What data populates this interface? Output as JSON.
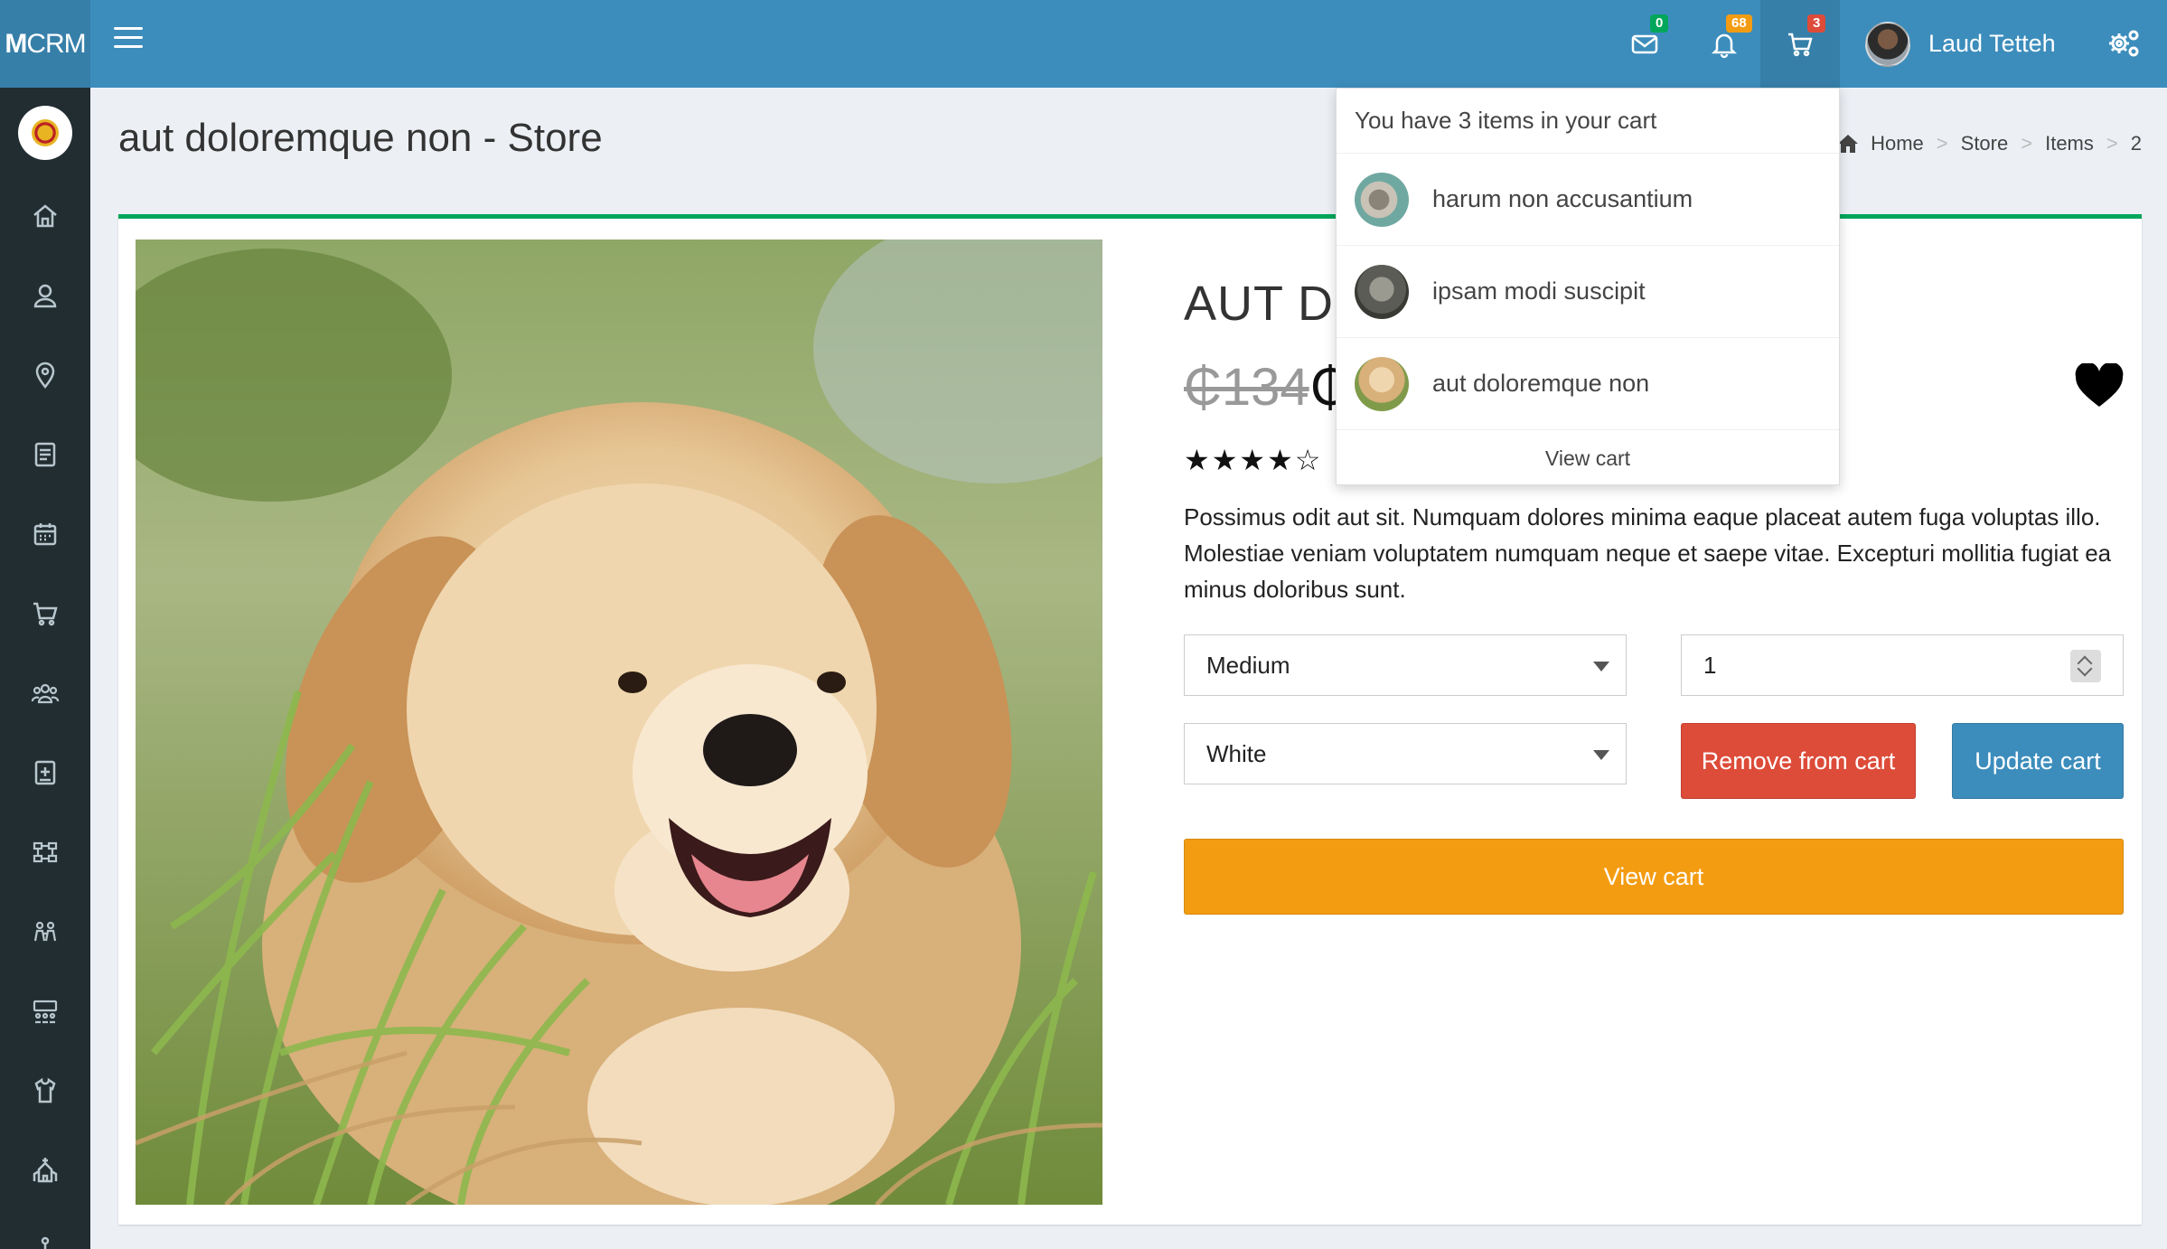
{
  "header": {
    "logo_bold": "M",
    "logo_rest": "CRM",
    "mail_count": "0",
    "notif_count": "68",
    "cart_count": "3",
    "user_name": "Laud Tetteh"
  },
  "page": {
    "title": "aut doloremque non - Store",
    "breadcrumb": [
      "Home",
      "Store",
      "Items",
      "2"
    ]
  },
  "product": {
    "name": "AUT DC",
    "old_price": "₵134",
    "current_price": "₵",
    "rating": 4,
    "rating_max": 5,
    "stars": "★★★★☆",
    "description": "Possimus odit aut sit. Numquam dolores minima eaque placeat autem fuga voluptas illo. Molestiae veniam voluptatem numquam neque et saepe vitae. Excepturi mollitia fugiat ea minus doloribus sunt.",
    "size": "Medium",
    "color": "White",
    "quantity": "1",
    "remove_label": "Remove from cart",
    "update_label": "Update cart",
    "view_cart_label": "View cart"
  },
  "cart_dropdown": {
    "header": "You have 3 items in your cart",
    "items": [
      {
        "name": "harum non accusantium"
      },
      {
        "name": "ipsam modi suscipit"
      },
      {
        "name": "aut doloremque non"
      }
    ],
    "footer": "View cart"
  },
  "colors": {
    "header": "#3c8dbc",
    "sidebar": "#222d32",
    "accent_green": "#00a65a",
    "danger": "#dd4b39",
    "warning": "#f39c12"
  }
}
